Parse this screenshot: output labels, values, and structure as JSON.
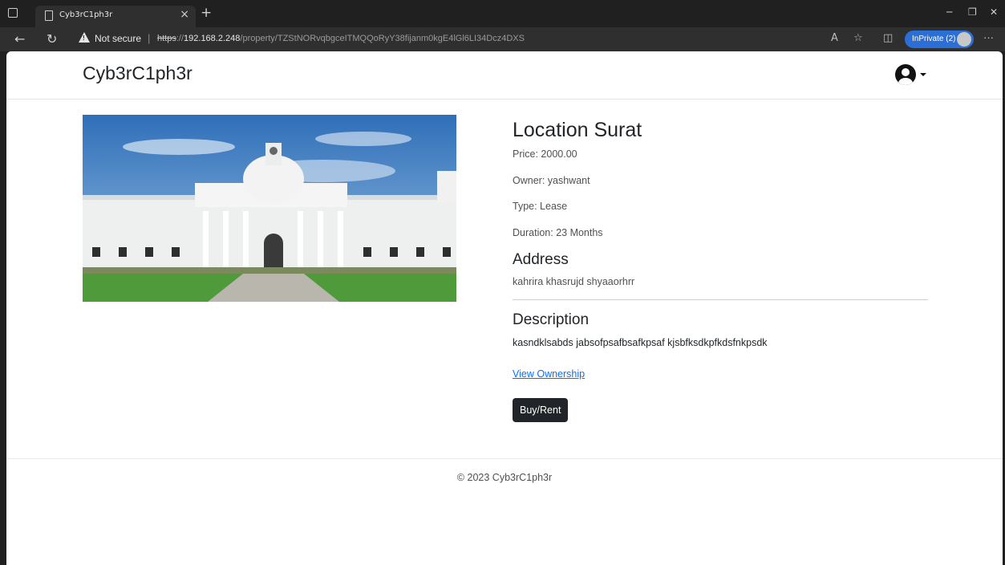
{
  "browser": {
    "tab_title": "Cyb3rC1ph3r",
    "tab_close": "×",
    "new_tab": "+",
    "security_label": "Not secure",
    "separator": "|",
    "url_scheme": "https",
    "url_sep": "://",
    "url_host": "192.168.2.248",
    "url_path": "/property/TZStNORvqbgceITMQQoRyY38fijanm0kgE4lGl6LI34Dcz4DXS",
    "inprivate_label": "InPrivate (2)",
    "icons": {
      "back": "arrow-left-icon",
      "reload": "reload-icon",
      "read_aloud": "read-aloud-icon",
      "favorite": "star-icon",
      "split_screen": "split-screen-icon",
      "more": "more-icon"
    }
  },
  "navbar": {
    "brand": "Cyb3rC1ph3r",
    "user_menu_icon": "user-circle-icon"
  },
  "property": {
    "image_alt": "Building with white dome and columns",
    "title": "Location Surat",
    "price": "Price: 2000.00",
    "owner": "Owner: yashwant",
    "type": "Type: Lease",
    "duration": "Duration: 23 Months",
    "address_heading": "Address",
    "address": "kahrira khasrujd shyaaorhrr",
    "description_heading": "Description",
    "description": "kasndklsabds jabsofpsafbsafkpsaf kjsbfksdkpfkdsfnkpsdk",
    "view_ownership": "View Ownership",
    "buy_rent": "Buy/Rent"
  },
  "footer": {
    "copyright": "© 2023 Cyb3rC1ph3r"
  },
  "colors": {
    "accent_link": "#0d6efd",
    "button_dark": "#212529",
    "inprivate_badge": "#2b6fd6"
  }
}
